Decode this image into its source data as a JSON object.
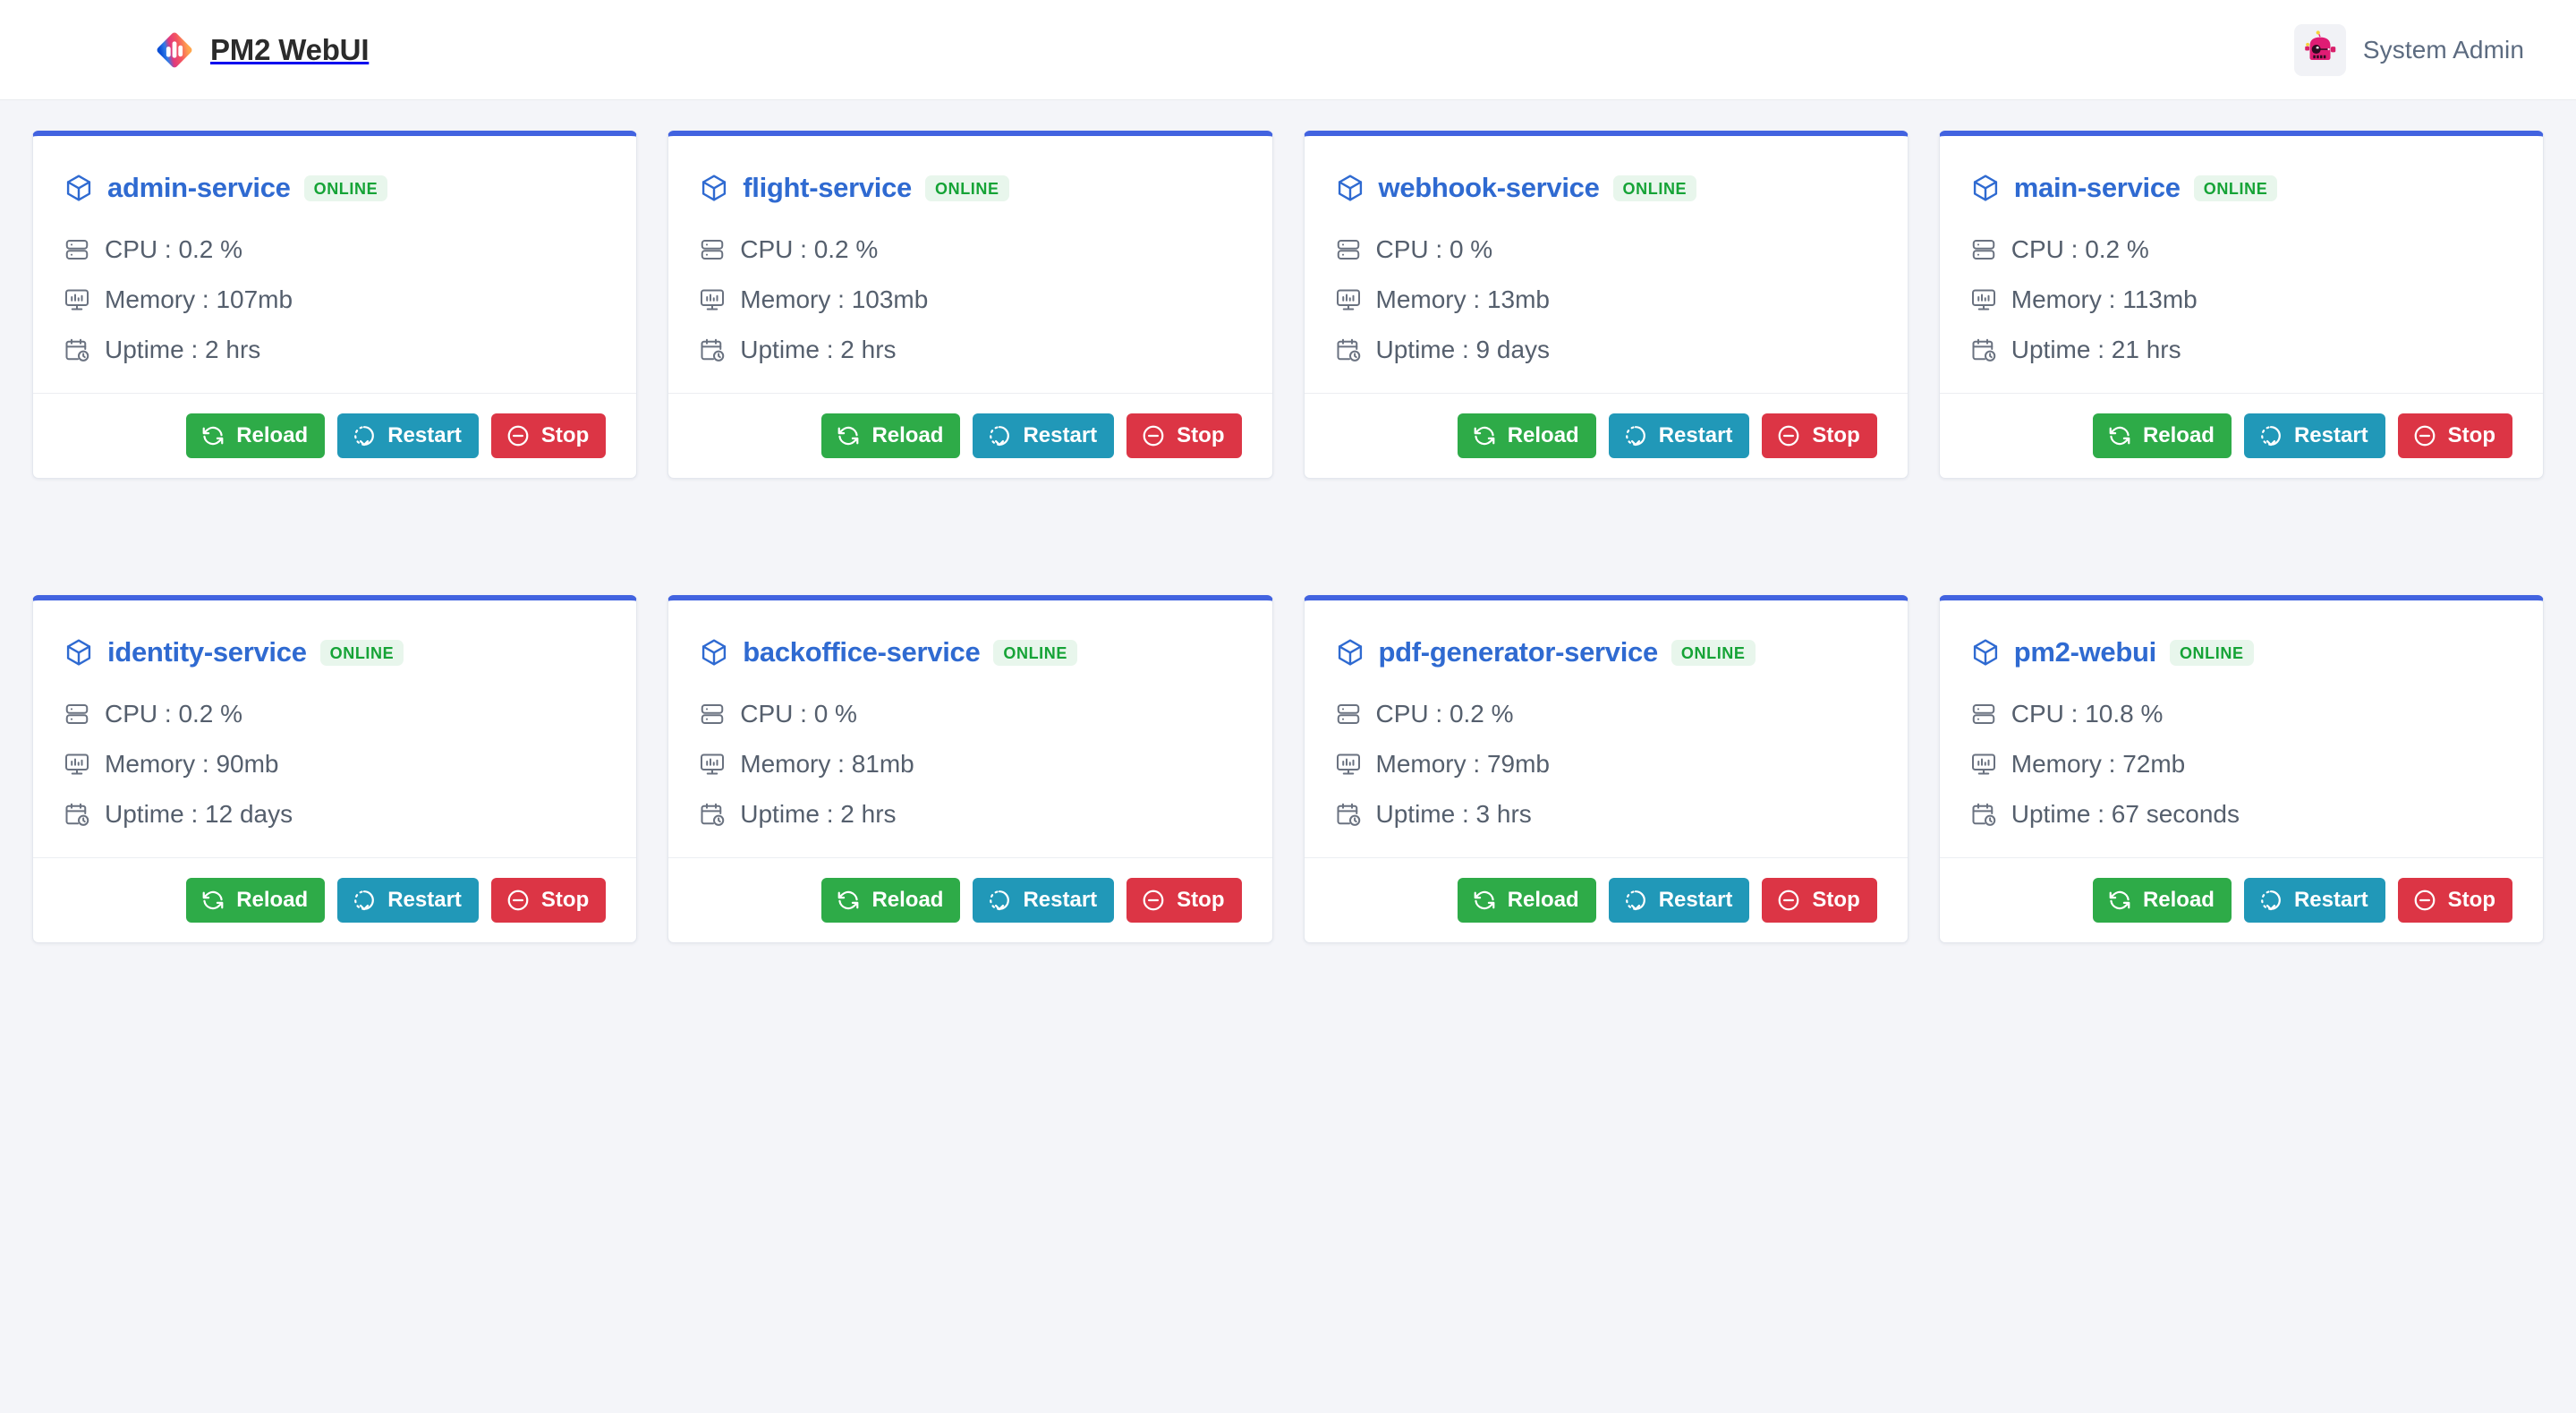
{
  "header": {
    "brand_title": "PM2 WebUI",
    "logo_icon": "pm2-diamond-logo-icon",
    "user_name": "System Admin",
    "avatar_icon": "robot-avatar-icon"
  },
  "labels": {
    "cpu": "CPU",
    "memory": "Memory",
    "uptime": "Uptime",
    "separator": " : "
  },
  "buttons": {
    "reload": "Reload",
    "restart": "Restart",
    "stop": "Stop"
  },
  "colors": {
    "card_top_border": "#4263e0",
    "service_name": "#2f6ad1",
    "badge_text": "#15a336",
    "badge_bg": "#e8f6ec",
    "reload": "#2eab48",
    "restart": "#2198b8",
    "stop": "#dc3545",
    "page_bg": "#f4f5f9"
  },
  "services": [
    {
      "name": "admin-service",
      "status": "ONLINE",
      "cpu": "CPU : 0.2 %",
      "memory": "Memory : 107mb",
      "uptime": "Uptime : 2 hrs"
    },
    {
      "name": "flight-service",
      "status": "ONLINE",
      "cpu": "CPU : 0.2 %",
      "memory": "Memory : 103mb",
      "uptime": "Uptime : 2 hrs"
    },
    {
      "name": "webhook-service",
      "status": "ONLINE",
      "cpu": "CPU : 0 %",
      "memory": "Memory : 13mb",
      "uptime": "Uptime : 9 days"
    },
    {
      "name": "main-service",
      "status": "ONLINE",
      "cpu": "CPU : 0.2 %",
      "memory": "Memory : 113mb",
      "uptime": "Uptime : 21 hrs"
    },
    {
      "name": "identity-service",
      "status": "ONLINE",
      "cpu": "CPU : 0.2 %",
      "memory": "Memory : 90mb",
      "uptime": "Uptime : 12 days"
    },
    {
      "name": "backoffice-service",
      "status": "ONLINE",
      "cpu": "CPU : 0 %",
      "memory": "Memory : 81mb",
      "uptime": "Uptime : 2 hrs"
    },
    {
      "name": "pdf-generator-service",
      "status": "ONLINE",
      "cpu": "CPU : 0.2 %",
      "memory": "Memory : 79mb",
      "uptime": "Uptime : 3 hrs"
    },
    {
      "name": "pm2-webui",
      "status": "ONLINE",
      "cpu": "CPU : 10.8 %",
      "memory": "Memory : 72mb",
      "uptime": "Uptime : 67 seconds"
    }
  ]
}
